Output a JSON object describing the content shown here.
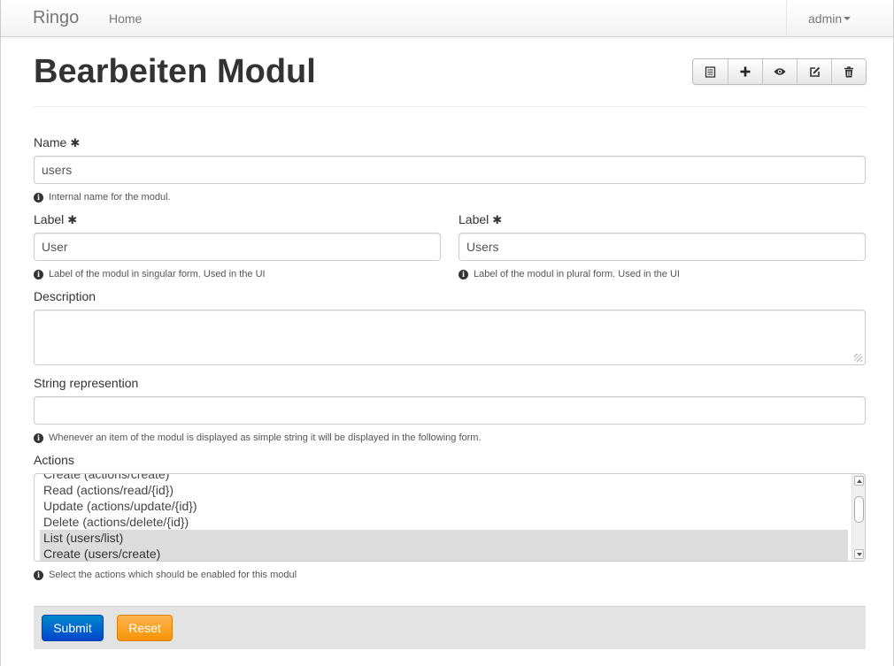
{
  "navbar": {
    "brand": "Ringo",
    "home": "Home",
    "user": "admin"
  },
  "page": {
    "title": "Bearbeiten Modul",
    "toolbar_icons": [
      "list-icon",
      "plus-icon",
      "eye-icon",
      "edit-icon",
      "trash-icon"
    ]
  },
  "form": {
    "name": {
      "label": "Name",
      "required_mark": "✱",
      "value": "users",
      "help": "Internal name for the modul."
    },
    "label_singular": {
      "label": "Label",
      "required_mark": "✱",
      "value": "User",
      "help": "Label of the modul in singular form. Used in the UI"
    },
    "label_plural": {
      "label": "Label",
      "required_mark": "✱",
      "value": "Users",
      "help": "Label of the modul in plural form. Used in the UI"
    },
    "description": {
      "label": "Description",
      "value": ""
    },
    "string_representation": {
      "label": "String represention",
      "value": "",
      "help": "Whenever an item of the modul is displayed as simple string it will be displayed in the following form."
    },
    "actions": {
      "label": "Actions",
      "options": [
        {
          "text": "Create (actions/create)",
          "selected": false
        },
        {
          "text": "Read (actions/read/{id})",
          "selected": false
        },
        {
          "text": "Update (actions/update/{id})",
          "selected": false
        },
        {
          "text": "Delete (actions/delete/{id})",
          "selected": false
        },
        {
          "text": "List (users/list)",
          "selected": true
        },
        {
          "text": "Create (users/create)",
          "selected": true
        }
      ],
      "help": "Select the actions which should be enabled for this modul"
    },
    "submit_label": "Submit",
    "reset_label": "Reset"
  },
  "colors": {
    "submit": "#0074cc",
    "reset": "#faa732",
    "selected_option": "#dcdcdc"
  }
}
